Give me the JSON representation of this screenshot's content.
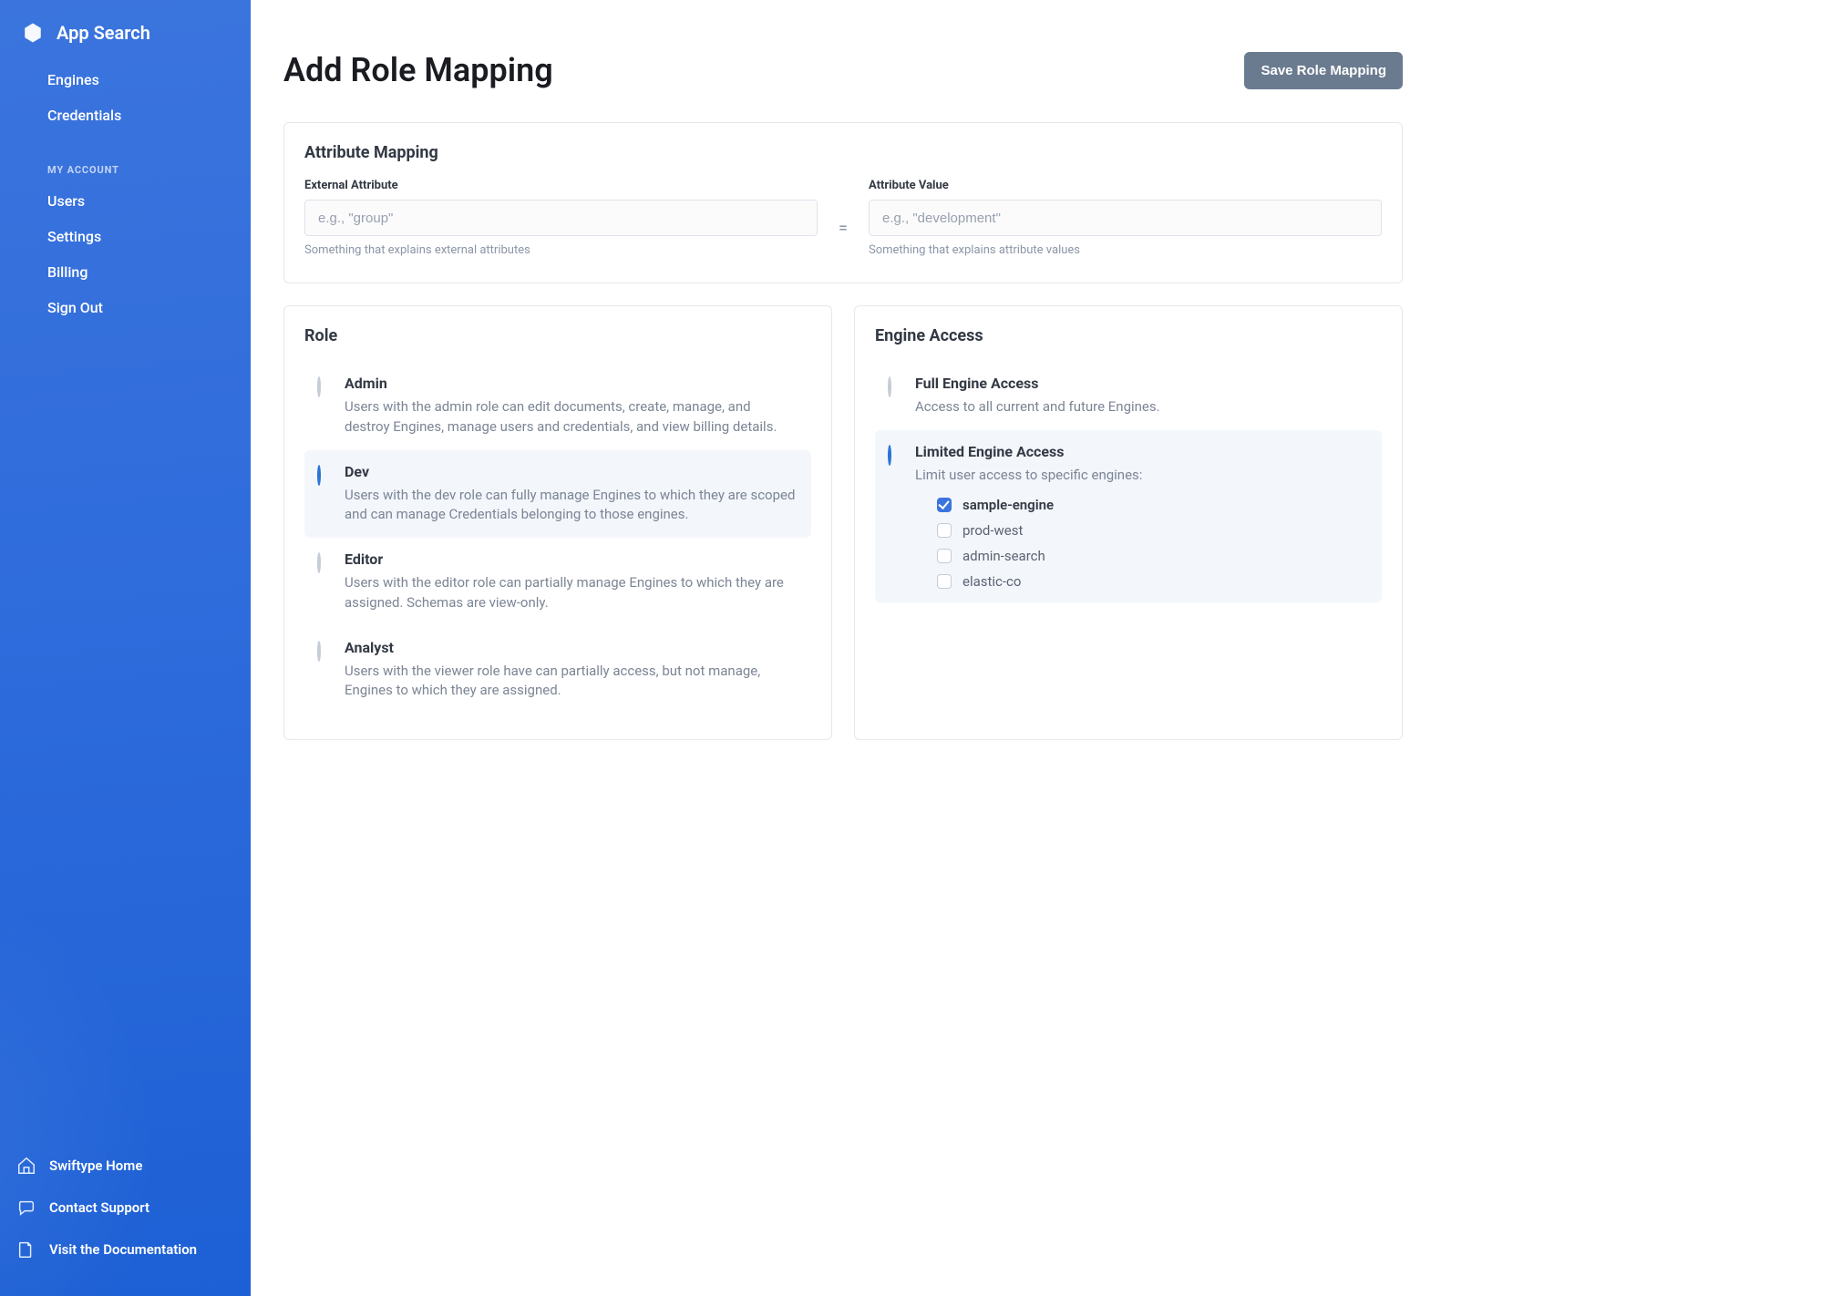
{
  "brand": {
    "title": "App Search"
  },
  "nav": {
    "items_top": [
      "Engines",
      "Credentials"
    ],
    "account_heading": "MY ACCOUNT",
    "items_account": [
      "Users",
      "Settings",
      "Billing",
      "Sign Out"
    ],
    "bottom_links": [
      "Swiftype Home",
      "Contact Support",
      "Visit the Documentation"
    ]
  },
  "page": {
    "title": "Add Role Mapping",
    "save_button": "Save Role Mapping"
  },
  "attribute_mapping": {
    "title": "Attribute Mapping",
    "external_attribute": {
      "label": "External Attribute",
      "placeholder": "e.g., \"group\"",
      "help": "Something that explains external attributes",
      "value": ""
    },
    "equals": "=",
    "attribute_value": {
      "label": "Attribute Value",
      "placeholder": "e.g., \"development\"",
      "help": "Something that explains attribute values",
      "value": ""
    }
  },
  "role": {
    "title": "Role",
    "selected": "Dev",
    "options": [
      {
        "name": "Admin",
        "desc": "Users with the admin role can edit documents, create, manage, and destroy Engines, manage users and credentials, and view billing details."
      },
      {
        "name": "Dev",
        "desc": "Users with the dev role can fully manage Engines to which they are scoped and can manage Credentials belonging to those engines."
      },
      {
        "name": "Editor",
        "desc": "Users with the editor role can partially manage Engines to which they are assigned. Schemas are view-only."
      },
      {
        "name": "Analyst",
        "desc": "Users with the viewer role have can partially access, but not manage, Engines to which they are assigned."
      }
    ]
  },
  "engine_access": {
    "title": "Engine Access",
    "selected": "Limited Engine Access",
    "options": [
      {
        "name": "Full Engine Access",
        "desc": "Access to all current and future Engines."
      },
      {
        "name": "Limited Engine Access",
        "desc": "Limit user access to specific engines:"
      }
    ],
    "engines": [
      {
        "name": "sample-engine",
        "checked": true
      },
      {
        "name": "prod-west",
        "checked": false
      },
      {
        "name": "admin-search",
        "checked": false
      },
      {
        "name": "elastic-co",
        "checked": false
      }
    ]
  }
}
